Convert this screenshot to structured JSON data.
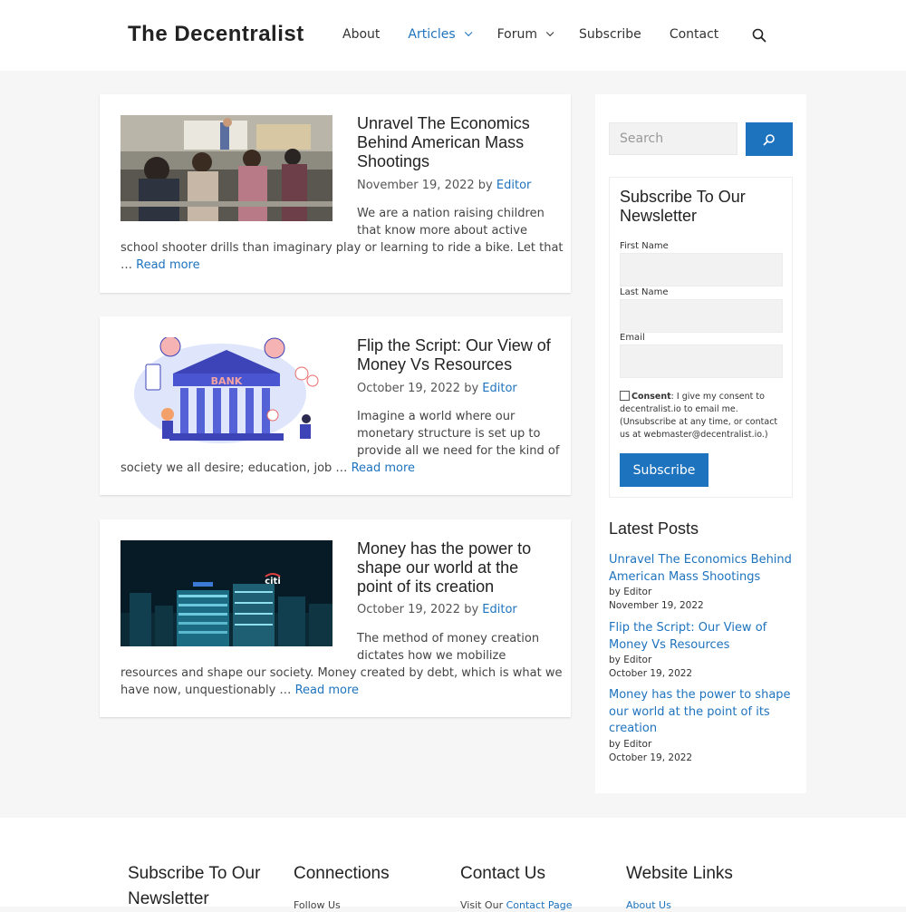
{
  "header": {
    "site_title": "The Decentralist",
    "nav": [
      {
        "label": "About"
      },
      {
        "label": "Articles"
      },
      {
        "label": "Forum"
      },
      {
        "label": "Subscribe"
      },
      {
        "label": "Contact"
      }
    ]
  },
  "posts": [
    {
      "title": "Unravel The Economics Behind American Mass Shootings",
      "date": "November 19, 2022",
      "by": "by",
      "author": "Editor",
      "excerpt_lines": [
        "We are a nation raising children",
        "that know more about active",
        "school shooter drills than imaginary play or learning to ride a bike. Let that",
        "… "
      ],
      "read_more": "Read more"
    },
    {
      "title": "Flip the Script: Our View of Money Vs Resources",
      "date": "October 19, 2022",
      "by": "by",
      "author": "Editor",
      "excerpt_lines": [
        "Imagine a world where our",
        "monetary structure is set up to",
        "provide all we need for the kind of",
        "society we all desire; education, job … "
      ],
      "read_more": "Read more",
      "image_text": "BANK"
    },
    {
      "title": "Money has the power to shape our world at the point of its creation",
      "date": "October 19, 2022",
      "by": "by",
      "author": "Editor",
      "excerpt_lines": [
        "The method of money creation",
        "dictates how we mobilize",
        "resources and shape our society. Money created by debt, which is what we",
        "have now, unquestionably … "
      ],
      "read_more": "Read more",
      "image_text": "citi"
    }
  ],
  "sidebar": {
    "search_placeholder": "Search",
    "newsletter": {
      "title": "Subscribe To Our Newsletter",
      "first_name_label": "First Name",
      "last_name_label": "Last Name",
      "email_label": "Email",
      "consent_bold": "Consent",
      "consent_text": ": I give my consent to decentralist.io to email me. (Unsubscribe at any time, or contact us at webmaster@decentralist.io.)",
      "button": "Subscribe"
    },
    "latest_title": "Latest Posts",
    "latest": [
      {
        "title": "Unravel The Economics Behind American Mass Shootings",
        "by": "by Editor",
        "date": "November 19, 2022"
      },
      {
        "title": "Flip the Script: Our View of Money Vs Resources",
        "by": "by Editor",
        "date": "October 19, 2022"
      },
      {
        "title": "Money has the power to shape our world at the point of its creation",
        "by": "by Editor",
        "date": "October 19, 2022"
      }
    ]
  },
  "footer": {
    "columns": [
      {
        "heading": "Subscribe To Our Newsletter",
        "text": ""
      },
      {
        "heading": "Connections",
        "text": "Follow Us"
      },
      {
        "heading": "Contact Us",
        "text": "Visit Our ",
        "link": "Contact Page"
      },
      {
        "heading": "Website Links",
        "text": "",
        "link": "About Us"
      }
    ]
  },
  "colors": {
    "accent": "#1e73be",
    "background": "#f6f6f6"
  },
  "icons": {
    "search": "search-icon",
    "dropdown": "chevron-down-icon"
  }
}
